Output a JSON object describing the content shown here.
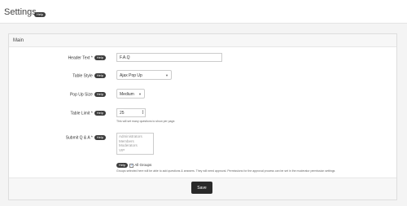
{
  "header": {
    "title": "Settings",
    "help": "Help"
  },
  "panel": {
    "title": "Main"
  },
  "help_badge": "Help",
  "fields": {
    "header_text": {
      "label": "Header Text *",
      "value": "F.A.Q"
    },
    "table_style": {
      "label": "Table Style",
      "value": "Ajax Pop Up"
    },
    "popup_size": {
      "label": "Pop Up Size",
      "value": "Medium"
    },
    "table_limit": {
      "label": "Table Limit *",
      "value": "25",
      "hint": "This will set many questions to show per page."
    },
    "submit_qa": {
      "label": "Submit Q & A *",
      "options": [
        "Administrators",
        "Members",
        "Moderators",
        "VIP"
      ],
      "all_groups_label": "All Groups",
      "all_groups_checked": true,
      "hint": "Groups selected here will be able to add questions & answers. They will need approval. Permissions for the approval process can be set in the moderator permission settings"
    }
  },
  "footer": {
    "save_label": "Save"
  }
}
